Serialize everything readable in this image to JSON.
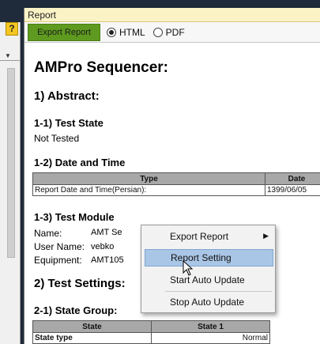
{
  "window": {
    "title": "Report"
  },
  "toolbar": {
    "export_label": "Export Report",
    "html_label": "HTML",
    "pdf_label": "PDF",
    "selected": "HTML"
  },
  "report": {
    "title": "AMPro Sequencer:",
    "abstract_heading": "1) Abstract:",
    "test_state_heading": "1-1) Test State",
    "test_state_value": "Not Tested",
    "datetime_heading": "1-2) Date and Time",
    "datetime_table": {
      "headers": [
        "Type",
        "Date"
      ],
      "rows": [
        [
          "Report Date and Time(Persian):",
          "1399/06/05"
        ]
      ]
    },
    "test_module_heading": "1-3) Test Module",
    "module_fields": [
      {
        "label": "Name:",
        "value": "AMT Se"
      },
      {
        "label": "User Name:",
        "value": "vebko"
      },
      {
        "label": "Equipment:",
        "value": "AMT105"
      }
    ],
    "test_settings_heading": "2) Test Settings:",
    "state_group_heading": "2-1) State Group:",
    "state_table": {
      "headers": [
        "State",
        "State 1"
      ],
      "rows": [
        [
          "State type",
          "Normal"
        ]
      ]
    }
  },
  "context_menu": {
    "items": [
      {
        "label": "Export Report",
        "submenu": true
      },
      {
        "label": "Report Setting",
        "highlighted": true
      },
      {
        "label": "Start Auto Update"
      },
      {
        "label": "Stop Auto Update"
      }
    ],
    "submenu_arrow": "▶"
  },
  "left_panel": {
    "help_label": "?"
  },
  "colors": {
    "export_button": "#5e9a1f",
    "title_bar": "#fbf3c6",
    "menu_highlight": "#aac6e6"
  }
}
